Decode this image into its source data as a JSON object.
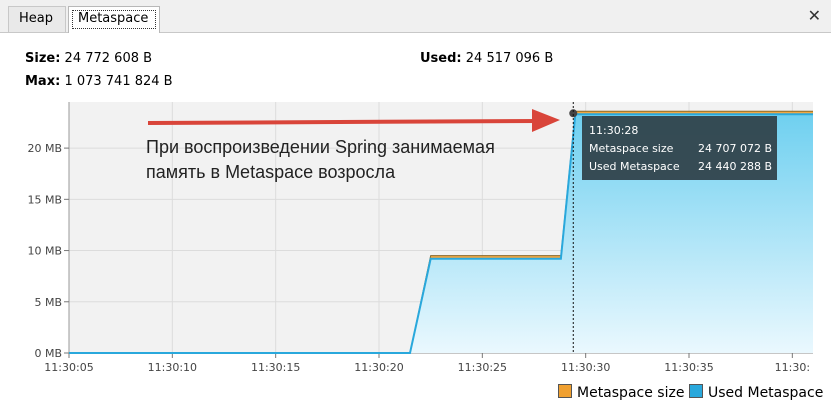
{
  "tabs": [
    {
      "label": "Heap"
    },
    {
      "label": "Metaspace",
      "selected": true
    }
  ],
  "close_icon": "close-icon",
  "stats": {
    "size_label": "Size:",
    "size_value": "24 772 608 B",
    "used_label": "Used:",
    "used_value": "24 517 096 B",
    "max_label": "Max:",
    "max_value": "1 073 741 824 B"
  },
  "annotation": {
    "line1": "При воспроизведении Spring занимаемая",
    "line2": "память в Metaspace возросла",
    "arrow_color": "#d9453a"
  },
  "tooltip": {
    "time": "11:30:28",
    "rows": [
      {
        "label": "Metaspace size",
        "value": "24 707 072 B"
      },
      {
        "label": "Used Metaspace",
        "value": "24 440 288 B"
      }
    ]
  },
  "colors": {
    "metaspace_size": "#f0a030",
    "used_metaspace": "#29a8dc",
    "used_fill_top": "#6fd0f0",
    "used_fill_bottom": "#eaf8fe"
  },
  "chart_data": {
    "type": "area",
    "x_tick_labels": [
      "11:30:05",
      "11:30:10",
      "11:30:15",
      "11:30:20",
      "11:30:25",
      "11:30:30",
      "11:30:35",
      "11:30:"
    ],
    "y_tick_labels": [
      "0 MB",
      "5 MB",
      "10 MB",
      "15 MB",
      "20 MB"
    ],
    "y_ticks": [
      0,
      5,
      10,
      15,
      20
    ],
    "xlim": [
      0,
      36
    ],
    "ylim": [
      0,
      24.5
    ],
    "series": [
      {
        "name": "Metaspace size",
        "x": [
          0,
          16.5,
          17.5,
          23.8,
          24.5,
          35.0,
          36
        ],
        "y": [
          0,
          0,
          9.5,
          9.5,
          23.6,
          23.6,
          23.6
        ]
      },
      {
        "name": "Used Metaspace",
        "x": [
          0,
          16.5,
          17.5,
          23.8,
          24.5,
          35.0,
          36
        ],
        "y": [
          0,
          0,
          9.2,
          9.2,
          23.3,
          23.3,
          23.3
        ]
      }
    ],
    "cursor_x": 24.4,
    "legend": [
      "Metaspace size",
      "Used Metaspace"
    ],
    "legend_position": "bottom-right",
    "grid": true
  }
}
